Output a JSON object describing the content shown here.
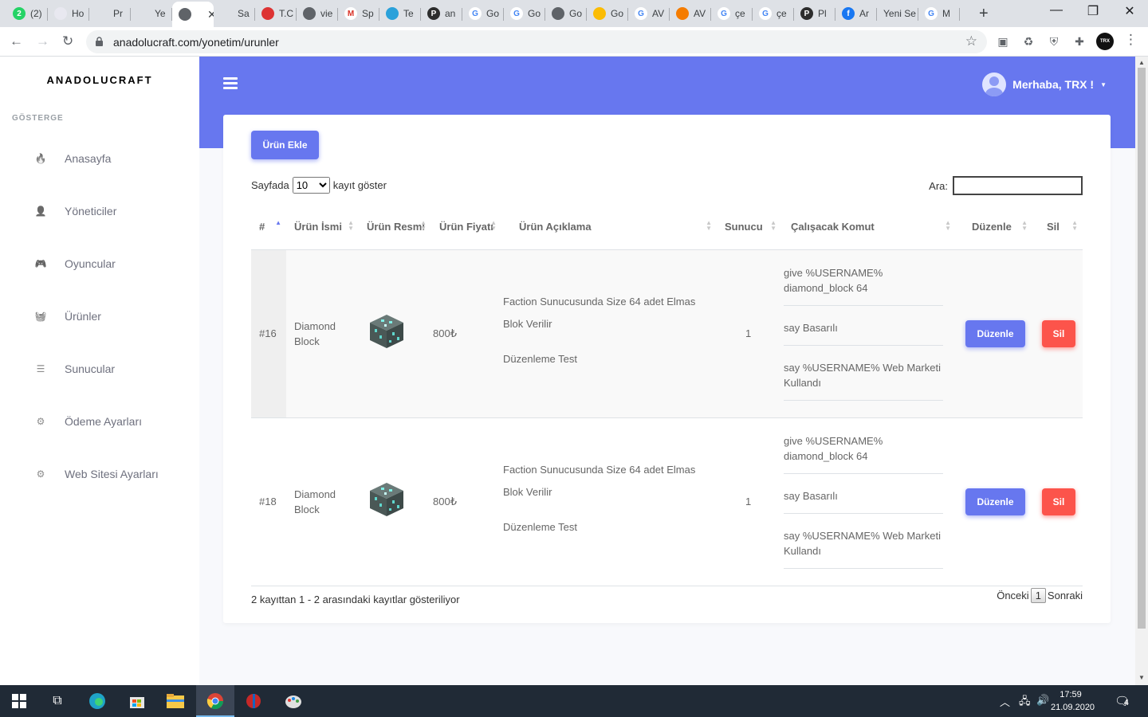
{
  "browser": {
    "tabs": [
      {
        "title": "(2)",
        "icon": "whatsapp-icon",
        "color": "#25d366",
        "glyph": "2"
      },
      {
        "title": "Ho",
        "icon": "red-circle-icon",
        "color": "#e8e8f0",
        "glyph": ""
      },
      {
        "title": "Pr",
        "icon": "mountain-icon",
        "color": "#dee1e6",
        "glyph": ""
      },
      {
        "title": "Ye",
        "icon": "mountain-icon",
        "color": "#dee1e6",
        "glyph": ""
      },
      {
        "title": "",
        "icon": "globe-icon",
        "color": "#5f6368",
        "glyph": "",
        "active": true
      },
      {
        "title": "Sa",
        "icon": "mountain-icon",
        "color": "#dee1e6",
        "glyph": ""
      },
      {
        "title": "T.C",
        "icon": "gov-icon",
        "color": "#d33",
        "glyph": ""
      },
      {
        "title": "vie",
        "icon": "globe-icon",
        "color": "#5f6368",
        "glyph": ""
      },
      {
        "title": "Sp",
        "icon": "gmail-icon",
        "color": "#fff",
        "glyph": "M"
      },
      {
        "title": "Te",
        "icon": "telegram-icon",
        "color": "#2aa1da",
        "glyph": ""
      },
      {
        "title": "an",
        "icon": "p-icon",
        "color": "#2d2d2d",
        "glyph": "P"
      },
      {
        "title": "Go",
        "icon": "google-icon",
        "color": "#fff",
        "glyph": "G"
      },
      {
        "title": "Go",
        "icon": "google-icon",
        "color": "#fff",
        "glyph": "G"
      },
      {
        "title": "Go",
        "icon": "globe-icon",
        "color": "#5f6368",
        "glyph": ""
      },
      {
        "title": "Go",
        "icon": "google-ads-icon",
        "color": "#fbbc04",
        "glyph": ""
      },
      {
        "title": "AV",
        "icon": "google-icon",
        "color": "#fff",
        "glyph": "G"
      },
      {
        "title": "AV",
        "icon": "box-icon",
        "color": "#f57c00",
        "glyph": ""
      },
      {
        "title": "çe",
        "icon": "google-icon",
        "color": "#fff",
        "glyph": "G"
      },
      {
        "title": "çe",
        "icon": "google-icon",
        "color": "#fff",
        "glyph": "G"
      },
      {
        "title": "Pl",
        "icon": "p-icon",
        "color": "#2d2d2d",
        "glyph": "P"
      },
      {
        "title": "Ar",
        "icon": "facebook-icon",
        "color": "#1877f2",
        "glyph": "f"
      },
      {
        "title": "Yeni Se",
        "icon": "",
        "color": "",
        "glyph": ""
      },
      {
        "title": "M",
        "icon": "google-icon",
        "color": "#fff",
        "glyph": "G"
      }
    ],
    "url": "anadolucraft.com/yonetim/urunler"
  },
  "sidebar": {
    "brand": "ANADOLUCRAFT",
    "heading": "GÖSTERGE",
    "items": [
      {
        "label": "Anasayfa",
        "icon": "fire-icon",
        "glyph": "🔥"
      },
      {
        "label": "Yöneticiler",
        "icon": "user-cog-icon",
        "glyph": "👤"
      },
      {
        "label": "Oyuncular",
        "icon": "gamepad-icon",
        "glyph": "🎮"
      },
      {
        "label": "Ürünler",
        "icon": "basket-icon",
        "glyph": "🧺"
      },
      {
        "label": "Sunucular",
        "icon": "server-icon",
        "glyph": "☰"
      },
      {
        "label": "Ödeme Ayarları",
        "icon": "payment-settings-icon",
        "glyph": "⚙"
      },
      {
        "label": "Web Sitesi Ayarları",
        "icon": "cogs-icon",
        "glyph": "⚙"
      }
    ]
  },
  "header": {
    "greeting": "Merhaba, TRX !"
  },
  "page": {
    "add_button": "Ürün Ekle",
    "length_prefix": "Sayfada",
    "length_value": "10",
    "length_suffix": "kayıt göster",
    "search_label": "Ara:",
    "columns": [
      "#",
      "Ürün İsmi",
      "Ürün Resmi",
      "Ürün Fiyatı",
      "Ürün Açıklama",
      "Sunucu",
      "Çalışacak Komut",
      "Düzenle",
      "Sil"
    ],
    "rows": [
      {
        "id": "#16",
        "name": "Diamond Block",
        "price": "800₺",
        "description": [
          "Faction Sunucusunda Size 64 adet Elmas",
          "Blok Verilir",
          "Düzenleme Test"
        ],
        "server": "1",
        "commands": [
          "give %USERNAME% diamond_block 64",
          "say Basarılı",
          "say %USERNAME% Web Marketi Kullandı"
        ],
        "edit_label": "Düzenle",
        "delete_label": "Sil"
      },
      {
        "id": "#18",
        "name": "Diamond Block",
        "price": "800₺",
        "description": [
          "Faction Sunucusunda Size 64 adet Elmas",
          "Blok Verilir",
          "Düzenleme Test"
        ],
        "server": "1",
        "commands": [
          "give %USERNAME% diamond_block 64",
          "say Basarılı",
          "say %USERNAME% Web Marketi Kullandı"
        ],
        "edit_label": "Düzenle",
        "delete_label": "Sil"
      }
    ],
    "info": "2 kayıttan 1 - 2 arasındaki kayıtlar gösteriliyor",
    "pager": {
      "prev": "Önceki",
      "current": "1",
      "next": "Sonraki"
    }
  },
  "taskbar": {
    "time": "17:59",
    "date": "21.09.2020",
    "notifications": "4"
  },
  "colors": {
    "accent": "#6777ef",
    "danger": "#fc544b"
  }
}
